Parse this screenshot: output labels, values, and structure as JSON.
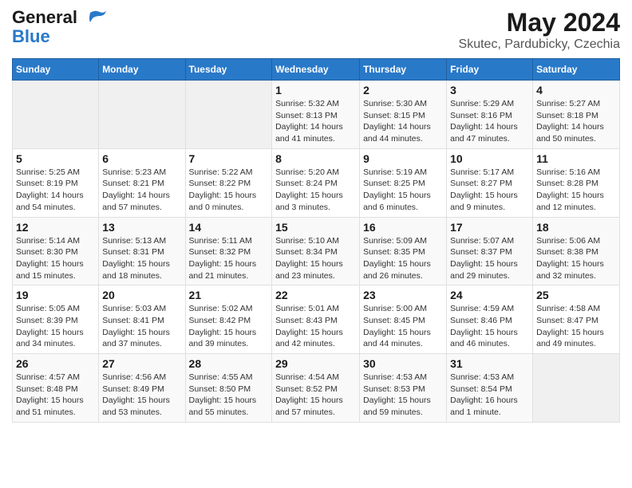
{
  "header": {
    "logo_line1": "General",
    "logo_line2": "Blue",
    "title": "May 2024",
    "subtitle": "Skutec, Pardubicky, Czechia"
  },
  "weekdays": [
    "Sunday",
    "Monday",
    "Tuesday",
    "Wednesday",
    "Thursday",
    "Friday",
    "Saturday"
  ],
  "weeks": [
    [
      {
        "day": "",
        "info": ""
      },
      {
        "day": "",
        "info": ""
      },
      {
        "day": "",
        "info": ""
      },
      {
        "day": "1",
        "info": "Sunrise: 5:32 AM\nSunset: 8:13 PM\nDaylight: 14 hours and 41 minutes."
      },
      {
        "day": "2",
        "info": "Sunrise: 5:30 AM\nSunset: 8:15 PM\nDaylight: 14 hours and 44 minutes."
      },
      {
        "day": "3",
        "info": "Sunrise: 5:29 AM\nSunset: 8:16 PM\nDaylight: 14 hours and 47 minutes."
      },
      {
        "day": "4",
        "info": "Sunrise: 5:27 AM\nSunset: 8:18 PM\nDaylight: 14 hours and 50 minutes."
      }
    ],
    [
      {
        "day": "5",
        "info": "Sunrise: 5:25 AM\nSunset: 8:19 PM\nDaylight: 14 hours and 54 minutes."
      },
      {
        "day": "6",
        "info": "Sunrise: 5:23 AM\nSunset: 8:21 PM\nDaylight: 14 hours and 57 minutes."
      },
      {
        "day": "7",
        "info": "Sunrise: 5:22 AM\nSunset: 8:22 PM\nDaylight: 15 hours and 0 minutes."
      },
      {
        "day": "8",
        "info": "Sunrise: 5:20 AM\nSunset: 8:24 PM\nDaylight: 15 hours and 3 minutes."
      },
      {
        "day": "9",
        "info": "Sunrise: 5:19 AM\nSunset: 8:25 PM\nDaylight: 15 hours and 6 minutes."
      },
      {
        "day": "10",
        "info": "Sunrise: 5:17 AM\nSunset: 8:27 PM\nDaylight: 15 hours and 9 minutes."
      },
      {
        "day": "11",
        "info": "Sunrise: 5:16 AM\nSunset: 8:28 PM\nDaylight: 15 hours and 12 minutes."
      }
    ],
    [
      {
        "day": "12",
        "info": "Sunrise: 5:14 AM\nSunset: 8:30 PM\nDaylight: 15 hours and 15 minutes."
      },
      {
        "day": "13",
        "info": "Sunrise: 5:13 AM\nSunset: 8:31 PM\nDaylight: 15 hours and 18 minutes."
      },
      {
        "day": "14",
        "info": "Sunrise: 5:11 AM\nSunset: 8:32 PM\nDaylight: 15 hours and 21 minutes."
      },
      {
        "day": "15",
        "info": "Sunrise: 5:10 AM\nSunset: 8:34 PM\nDaylight: 15 hours and 23 minutes."
      },
      {
        "day": "16",
        "info": "Sunrise: 5:09 AM\nSunset: 8:35 PM\nDaylight: 15 hours and 26 minutes."
      },
      {
        "day": "17",
        "info": "Sunrise: 5:07 AM\nSunset: 8:37 PM\nDaylight: 15 hours and 29 minutes."
      },
      {
        "day": "18",
        "info": "Sunrise: 5:06 AM\nSunset: 8:38 PM\nDaylight: 15 hours and 32 minutes."
      }
    ],
    [
      {
        "day": "19",
        "info": "Sunrise: 5:05 AM\nSunset: 8:39 PM\nDaylight: 15 hours and 34 minutes."
      },
      {
        "day": "20",
        "info": "Sunrise: 5:03 AM\nSunset: 8:41 PM\nDaylight: 15 hours and 37 minutes."
      },
      {
        "day": "21",
        "info": "Sunrise: 5:02 AM\nSunset: 8:42 PM\nDaylight: 15 hours and 39 minutes."
      },
      {
        "day": "22",
        "info": "Sunrise: 5:01 AM\nSunset: 8:43 PM\nDaylight: 15 hours and 42 minutes."
      },
      {
        "day": "23",
        "info": "Sunrise: 5:00 AM\nSunset: 8:45 PM\nDaylight: 15 hours and 44 minutes."
      },
      {
        "day": "24",
        "info": "Sunrise: 4:59 AM\nSunset: 8:46 PM\nDaylight: 15 hours and 46 minutes."
      },
      {
        "day": "25",
        "info": "Sunrise: 4:58 AM\nSunset: 8:47 PM\nDaylight: 15 hours and 49 minutes."
      }
    ],
    [
      {
        "day": "26",
        "info": "Sunrise: 4:57 AM\nSunset: 8:48 PM\nDaylight: 15 hours and 51 minutes."
      },
      {
        "day": "27",
        "info": "Sunrise: 4:56 AM\nSunset: 8:49 PM\nDaylight: 15 hours and 53 minutes."
      },
      {
        "day": "28",
        "info": "Sunrise: 4:55 AM\nSunset: 8:50 PM\nDaylight: 15 hours and 55 minutes."
      },
      {
        "day": "29",
        "info": "Sunrise: 4:54 AM\nSunset: 8:52 PM\nDaylight: 15 hours and 57 minutes."
      },
      {
        "day": "30",
        "info": "Sunrise: 4:53 AM\nSunset: 8:53 PM\nDaylight: 15 hours and 59 minutes."
      },
      {
        "day": "31",
        "info": "Sunrise: 4:53 AM\nSunset: 8:54 PM\nDaylight: 16 hours and 1 minute."
      },
      {
        "day": "",
        "info": ""
      }
    ]
  ]
}
